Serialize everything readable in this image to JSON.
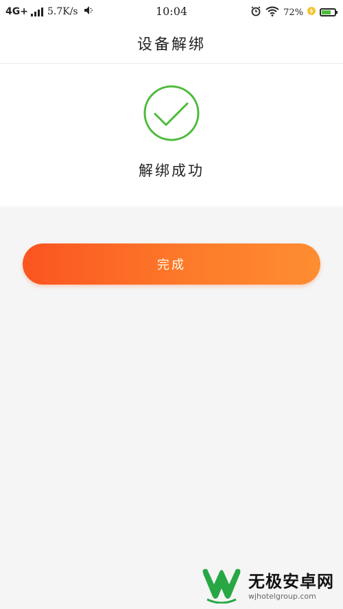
{
  "status_bar": {
    "network": "4G+",
    "speed": "5.7K/s",
    "time": "10:04",
    "battery_percent": "72%",
    "battery_level": 0.72,
    "icons": [
      "signal-icon",
      "mute-icon",
      "alarm-icon",
      "wifi-icon",
      "charging-icon",
      "battery-icon"
    ]
  },
  "header": {
    "title": "设备解绑"
  },
  "result": {
    "icon": "check-circle-icon",
    "message": "解绑成功"
  },
  "actions": {
    "done_label": "完成"
  },
  "watermark": {
    "brand": "无极安卓网",
    "domain": "wjhotelgroup.com"
  },
  "colors": {
    "success": "#4cbb3a",
    "button_gradient_start": "#fb5420",
    "button_gradient_end": "#fe8d31",
    "page_background": "#f5f5f5",
    "panel_background": "#ffffff",
    "watermark_green": "#28a745"
  }
}
